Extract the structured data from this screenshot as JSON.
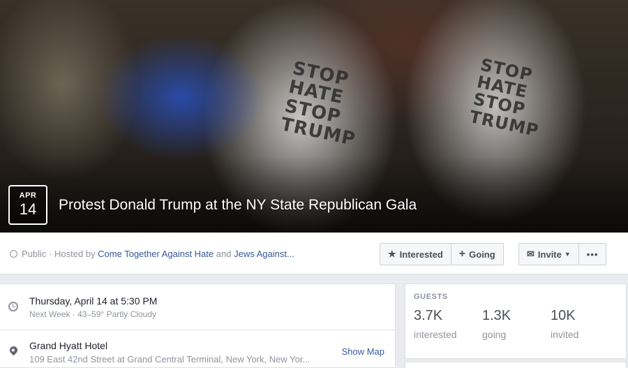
{
  "event": {
    "month": "APR",
    "day": "14",
    "title": "Protest Donald Trump at the NY State Republican Gala"
  },
  "hosted": {
    "privacy": "Public",
    "prefix": "· Hosted by",
    "host1": "Come Together Against Hate",
    "and": "and",
    "host2": "Jews Against..."
  },
  "actions": {
    "interested": "Interested",
    "going": "Going",
    "invite": "Invite",
    "more": "•••"
  },
  "details": {
    "when_primary": "Thursday, April 14 at 5:30 PM",
    "when_secondary": "Next Week · 43–59° Partly Cloudy",
    "where_primary": "Grand Hyatt Hotel",
    "where_secondary": "109 East 42nd Street at Grand Central Terminal, New York, New Yor...",
    "show_map": "Show Map"
  },
  "guests": {
    "label": "GUESTS",
    "interested_count": "3.7K",
    "interested_label": "interested",
    "going_count": "1.3K",
    "going_label": "going",
    "invited_count": "10K",
    "invited_label": "invited"
  },
  "icons": {
    "privacy": "globe-icon",
    "interested": "star-icon",
    "going": "plus-icon",
    "invite": "envelope-icon",
    "time": "clock-icon",
    "location": "map-pin-icon"
  },
  "colors": {
    "link": "#365899",
    "muted": "#90949c",
    "background": "#e9ebee"
  }
}
